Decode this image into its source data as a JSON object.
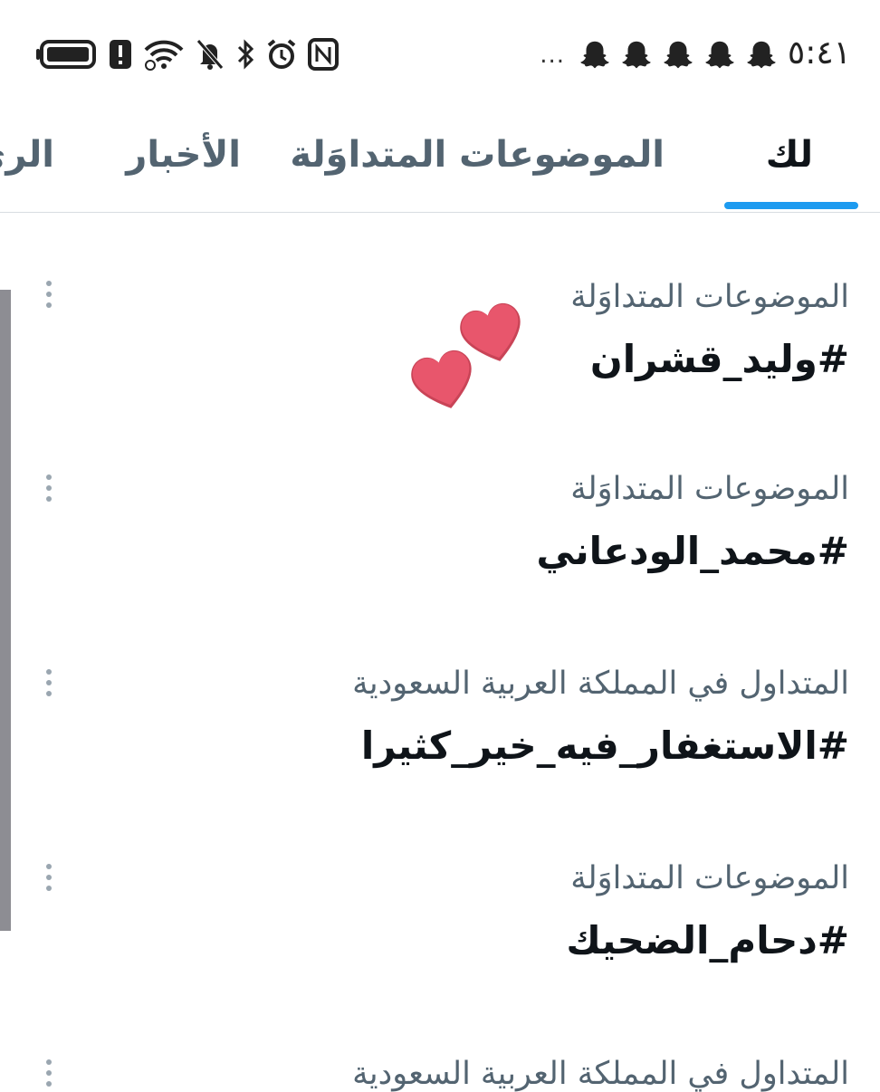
{
  "status_bar": {
    "time": "٥:٤١",
    "more_indicator": "..."
  },
  "tabs": [
    {
      "label": "لك",
      "active": true
    },
    {
      "label": "الموضوعات المتداوَلة",
      "active": false
    },
    {
      "label": "الأخبار",
      "active": false
    },
    {
      "label": "الري",
      "active": false
    }
  ],
  "trends": [
    {
      "context": "الموضوعات المتداوَلة",
      "title": "#وليد_قشران"
    },
    {
      "context": "الموضوعات المتداوَلة",
      "title": "#محمد_الودعاني"
    },
    {
      "context": "المتداول في المملكة العربية السعودية",
      "title": "#الاستغفار_فيه_خير_كثيرا"
    },
    {
      "context": "الموضوعات المتداوَلة",
      "title": "#دحام_الضحيك"
    },
    {
      "context": "المتداول في المملكة العربية السعودية",
      "title": ""
    }
  ],
  "colors": {
    "accent": "#1d9bf0",
    "primary_text": "#0f1419",
    "secondary_text": "#536471",
    "heart": "#e8566c"
  }
}
